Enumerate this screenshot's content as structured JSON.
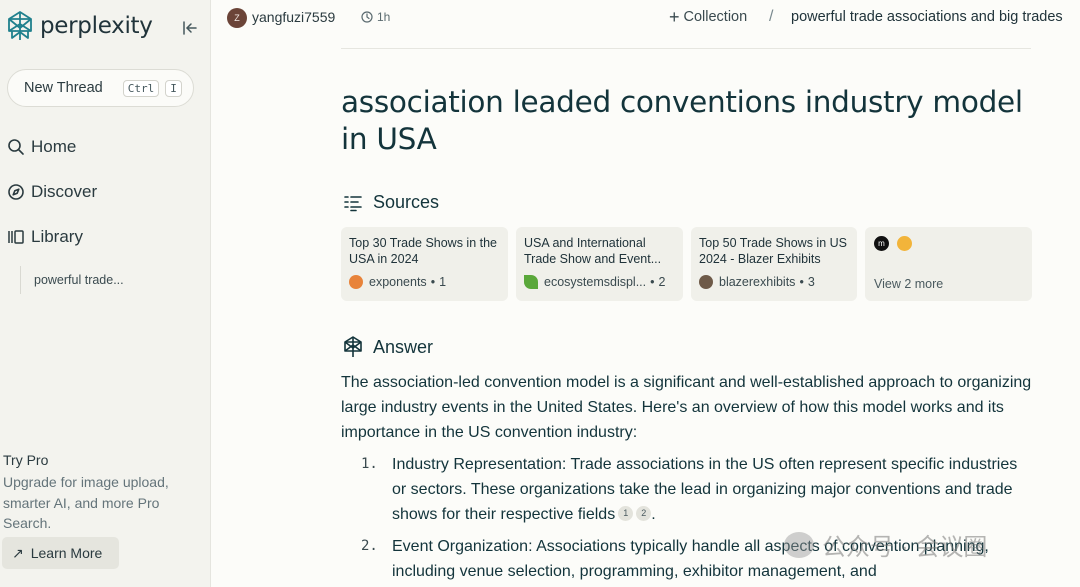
{
  "sidebar": {
    "logo": "perplexity",
    "new_thread": {
      "label": "New Thread",
      "key1": "Ctrl",
      "key2": "I"
    },
    "nav": [
      {
        "label": "Home",
        "icon": "search-icon"
      },
      {
        "label": "Discover",
        "icon": "compass-icon"
      },
      {
        "label": "Library",
        "icon": "library-icon"
      }
    ],
    "library_items": [
      "powerful trade..."
    ],
    "try_pro": {
      "title": "Try Pro",
      "description": "Upgrade for image upload, smarter AI, and more Pro Search.",
      "button": "Learn More"
    }
  },
  "header": {
    "avatar_initial": "Z",
    "username": "yangfuzi7559",
    "time": "1h",
    "collection": "Collection",
    "breadcrumb": "powerful trade associations and big trades"
  },
  "main": {
    "title": "association leaded conventions industry model in USA",
    "sources_heading": "Sources",
    "sources": [
      {
        "title": "Top 30 Trade Shows in the USA in 2024",
        "site": "exponents",
        "index": "1",
        "color": "#e8833a"
      },
      {
        "title": "USA and International Trade Show and Event...",
        "site": "ecosystemsdispl...",
        "index": "2",
        "color": "#5aa83a"
      },
      {
        "title": "Top 50 Trade Shows in US 2024 - Blazer Exhibits",
        "site": "blazerexhibits",
        "index": "3",
        "color": "#6e5a48"
      }
    ],
    "view_more": "View 2 more",
    "answer_heading": "Answer",
    "answer_intro": "The association-led convention model is a significant and well-established approach to organizing large industry events in the United States. Here's an overview of how this model works and its importance in the US convention industry:",
    "list": [
      {
        "num": "1.",
        "text": "Industry Representation: Trade associations in the US often represent specific industries or sectors. These organizations take the lead in organizing major conventions and trade shows for their respective fields",
        "cites": [
          "1",
          "2"
        ],
        "end": "."
      },
      {
        "num": "2.",
        "text": "Event Organization: Associations typically handle all aspects of convention planning, including venue selection, programming, exhibitor management, and"
      }
    ]
  },
  "watermark": "公众号 · 会议圈",
  "colors": {
    "accent": "#20808d",
    "text": "#13343b",
    "sidebar_bg": "#f3f3ee"
  }
}
